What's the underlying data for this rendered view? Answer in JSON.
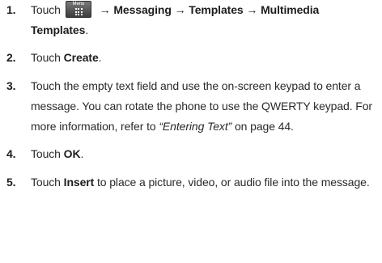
{
  "steps": [
    {
      "number": "1.",
      "touch": "Touch",
      "menu_key_label": "Menu",
      "arrow1": " → ",
      "messaging": "Messaging",
      "arrow2": " → ",
      "templates": "Templates",
      "arrow3": " → ",
      "multimedia_templates": "Multimedia Templates",
      "period": "."
    },
    {
      "number": "2.",
      "touch": "Touch ",
      "create": "Create",
      "period": "."
    },
    {
      "number": "3.",
      "text_before": "Touch the empty text field and use the on-screen keypad to enter a message. You can rotate the phone to use the QWERTY keypad. For more information, refer to ",
      "ref": "“Entering Text”",
      "text_after": " on page 44."
    },
    {
      "number": "4.",
      "touch": "Touch ",
      "ok": "OK",
      "period": "."
    },
    {
      "number": "5.",
      "touch": "Touch ",
      "insert": "Insert",
      "text_after": " to place a picture, video, or audio file into the message."
    }
  ],
  "icons": {
    "menu_key": "menu-key-icon"
  }
}
